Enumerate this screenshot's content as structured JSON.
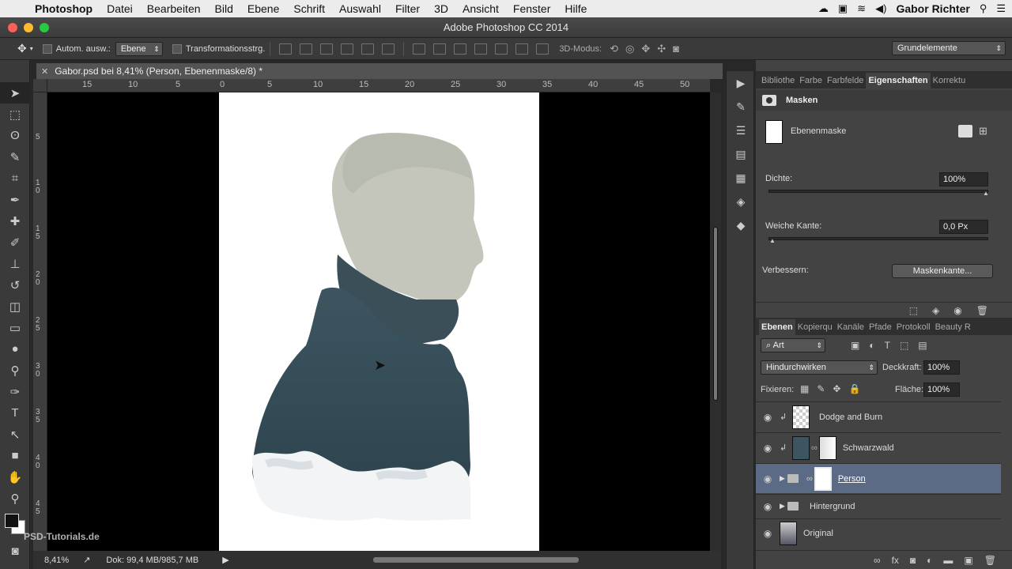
{
  "menubar": {
    "app": "Photoshop",
    "items": [
      "Datei",
      "Bearbeiten",
      "Bild",
      "Ebene",
      "Schrift",
      "Auswahl",
      "Filter",
      "3D",
      "Ansicht",
      "Fenster",
      "Hilfe"
    ],
    "user": "Gabor Richter"
  },
  "window": {
    "title": "Adobe Photoshop CC 2014"
  },
  "options": {
    "auto_select_label": "Autom. ausw.:",
    "auto_select_value": "Ebene",
    "transform_label": "Transformationsstrg.",
    "mode_3d_label": "3D-Modus:",
    "workspace": "Grundelemente"
  },
  "document": {
    "tab_title": "Gabor.psd bei 8,41% (Person, Ebenenmaske/8) *",
    "ruler_h": [
      "15",
      "10",
      "5",
      "0",
      "5",
      "10",
      "15",
      "20",
      "25",
      "30",
      "35",
      "40",
      "45",
      "50"
    ],
    "ruler_v": [
      "5",
      "1\n0",
      "1\n5",
      "2\n0",
      "2\n5",
      "3\n0",
      "3\n5",
      "4\n0",
      "4\n5"
    ],
    "zoom": "8,41%",
    "doc_size": "Dok: 99,4 MB/985,7 MB",
    "watermark": "PSD-Tutorials.de"
  },
  "properties": {
    "tabs": [
      "Bibliothe",
      "Farbe",
      "Farbfelde",
      "Eigenschaften",
      "Korrektu"
    ],
    "active_tab": "Eigenschaften",
    "header": "Masken",
    "mask_label": "Ebenenmaske",
    "density_label": "Dichte:",
    "density_value": "100%",
    "density_level": 1.0,
    "feather_label": "Weiche Kante:",
    "feather_value": "0,0 Px",
    "feather_level": 0.0,
    "refine_label": "Verbessern:",
    "refine_button": "Maskenkante..."
  },
  "layers": {
    "tabs": [
      "Ebenen",
      "Kopierqu",
      "Kanäle",
      "Pfade",
      "Protokoll",
      "Beauty R"
    ],
    "active_tab": "Ebenen",
    "filter_kind": "Art",
    "blend_mode": "Hindurchwirken",
    "opacity_label": "Deckkraft:",
    "opacity_value": "100%",
    "lock_label": "Fixieren:",
    "fill_label": "Fläche:",
    "fill_value": "100%",
    "items": [
      {
        "name": "Dodge and Burn"
      },
      {
        "name": "Schwarzwald"
      },
      {
        "name": "Person"
      },
      {
        "name": "Hintergrund"
      },
      {
        "name": "Original"
      }
    ]
  }
}
